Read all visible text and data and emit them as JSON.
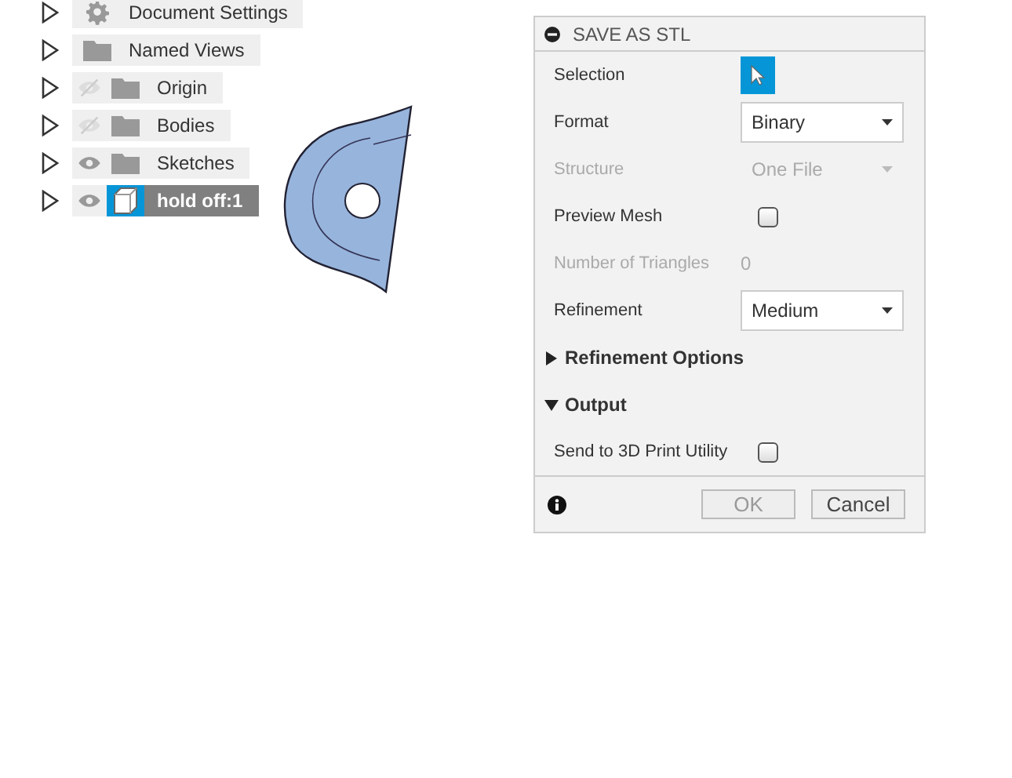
{
  "browser": {
    "items": [
      {
        "label": "Document Settings",
        "kind": "settings",
        "selected": false
      },
      {
        "label": "Named Views",
        "kind": "folder",
        "selected": false
      },
      {
        "label": "Origin",
        "kind": "folder",
        "visible": false,
        "selected": false
      },
      {
        "label": "Bodies",
        "kind": "folder",
        "visible": false,
        "selected": false
      },
      {
        "label": "Sketches",
        "kind": "folder",
        "visible": true,
        "selected": false
      },
      {
        "label": "hold off:1",
        "kind": "component",
        "visible": true,
        "selected": true
      }
    ]
  },
  "dialog": {
    "title": "SAVE AS STL",
    "rows": [
      {
        "kind": "selection",
        "label": "Selection",
        "disabled": false
      },
      {
        "kind": "dropdown",
        "label": "Format",
        "value": "Binary",
        "disabled": false
      },
      {
        "kind": "dropdown",
        "label": "Structure",
        "value": "One File",
        "disabled": true
      },
      {
        "kind": "checkbox",
        "label": "Preview Mesh",
        "checked": false,
        "disabled": false
      },
      {
        "kind": "info",
        "label": "Number of Triangles",
        "value": "0",
        "disabled": true
      },
      {
        "kind": "dropdown",
        "label": "Refinement",
        "value": "Medium",
        "disabled": false
      },
      {
        "kind": "section",
        "label": "Refinement Options",
        "expanded": false
      },
      {
        "kind": "section",
        "label": "Output",
        "expanded": true
      },
      {
        "kind": "checkbox",
        "label": "Send to 3D Print Utility",
        "checked": false,
        "disabled": false
      }
    ],
    "buttons": [
      {
        "label": "OK",
        "disabled": true
      },
      {
        "label": "Cancel",
        "disabled": false
      }
    ]
  }
}
